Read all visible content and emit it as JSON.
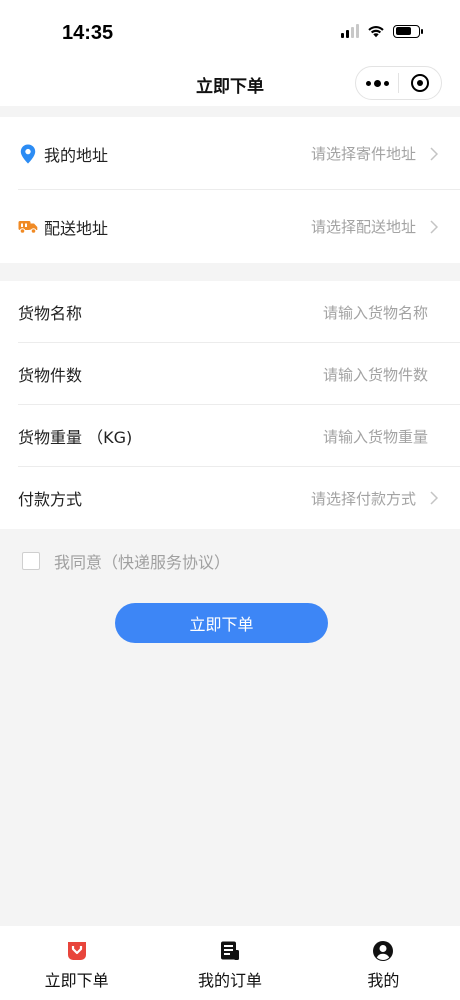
{
  "status_bar": {
    "time": "14:35"
  },
  "nav": {
    "title": "立即下单"
  },
  "address_section": {
    "items": [
      {
        "label": "我的地址",
        "placeholder": "请选择寄件地址",
        "icon": "location-pin-icon",
        "icon_color": "#2c8cf4"
      },
      {
        "label": "配送地址",
        "placeholder": "请选择配送地址",
        "icon": "delivery-truck-icon",
        "icon_color": "#f08a24"
      }
    ]
  },
  "goods_section": {
    "items": [
      {
        "label": "货物名称",
        "placeholder": "请输入货物名称"
      },
      {
        "label": "货物件数",
        "placeholder": "请输入货物件数"
      },
      {
        "label": "货物重量 （KG)",
        "placeholder": "请输入货物重量"
      },
      {
        "label": "付款方式",
        "placeholder": "请选择付款方式"
      }
    ]
  },
  "agreement": {
    "text": "我同意（快递服务协议）",
    "checked": false
  },
  "submit": {
    "label": "立即下单",
    "color": "#3d86f6"
  },
  "tabbar": {
    "active_color": "#e8453c",
    "tabs": [
      {
        "label": "立即下单",
        "icon": "order-box-icon",
        "active": true
      },
      {
        "label": "我的订单",
        "icon": "order-list-icon",
        "active": false
      },
      {
        "label": "我的",
        "icon": "user-profile-icon",
        "active": false
      }
    ]
  }
}
